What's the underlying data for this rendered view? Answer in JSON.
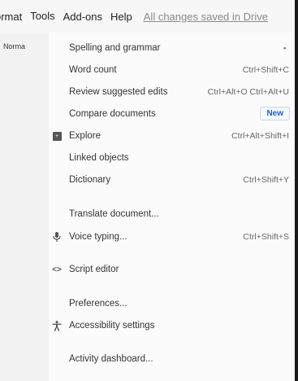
{
  "menubar": {
    "items": [
      "ormat",
      "Tools",
      "Add-ons",
      "Help"
    ],
    "status": "All changes saved in Drive"
  },
  "toolbar": {
    "style": "Norma"
  },
  "tools_menu": {
    "items": [
      {
        "label": "Spelling and grammar",
        "submenu_arrow": "▸"
      },
      {
        "label": "Word count",
        "shortcut": "Ctrl+Shift+C"
      },
      {
        "label": "Review suggested edits",
        "shortcut": "Ctrl+Alt+O Ctrl+Alt+U"
      },
      {
        "label": "Compare documents",
        "badge": "New"
      },
      {
        "label": "Explore",
        "shortcut": "Ctrl+Alt+Shift+I",
        "icon": "explore-icon"
      },
      {
        "label": "Linked objects"
      },
      {
        "label": "Dictionary",
        "shortcut": "Ctrl+Shift+Y"
      },
      {
        "label": "Translate document..."
      },
      {
        "label": "Voice typing...",
        "shortcut": "Ctrl+Shift+S",
        "icon": "microphone-icon"
      },
      {
        "label": "Script editor",
        "icon": "code-icon"
      },
      {
        "label": "Preferences..."
      },
      {
        "label": "Accessibility settings",
        "icon": "accessibility-icon"
      },
      {
        "label": "Activity dashboard..."
      }
    ]
  }
}
